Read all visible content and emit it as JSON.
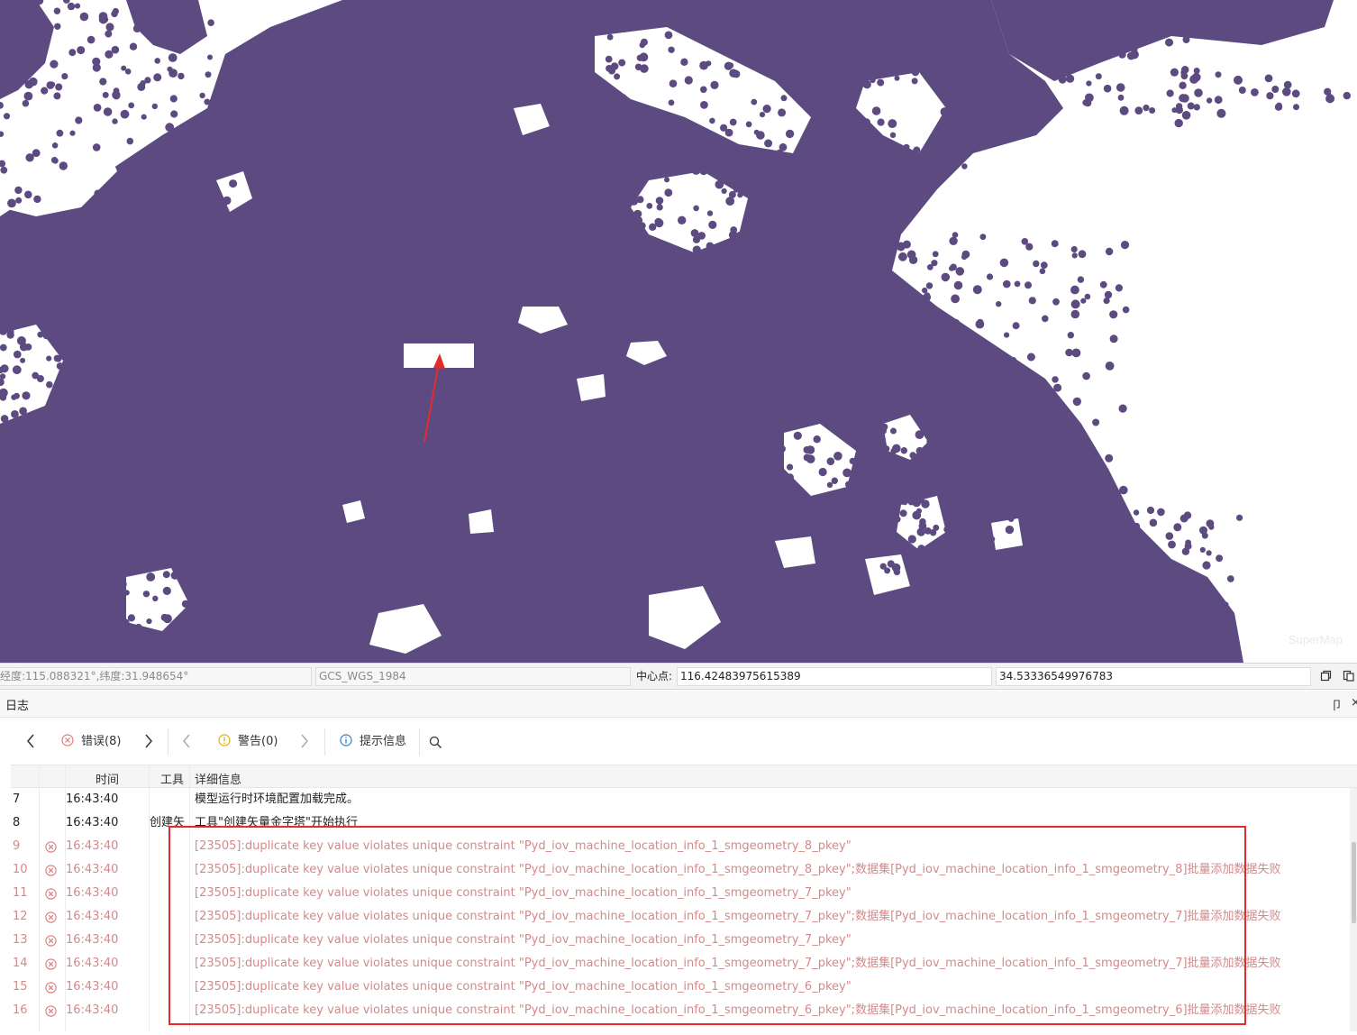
{
  "status_bar": {
    "coordinates": "经度:115.088321°,纬度:31.948654°",
    "crs": "GCS_WGS_1984",
    "center_label": "中心点:",
    "center_x": "116.42483975615389",
    "center_y": "34.53336549976783"
  },
  "map": {
    "point_color": "#5c4a80",
    "watermark": "SuperMap"
  },
  "log_panel": {
    "title": "日志",
    "toolbar": {
      "errors_label": "错误(8)",
      "warnings_label": "警告(0)",
      "info_label": "提示信息"
    },
    "columns": [
      "",
      "",
      "时间",
      "工具",
      "详细信息"
    ],
    "rows": [
      {
        "index": "7",
        "time": "16:43:40",
        "tool": "",
        "message": "模型运行时环境配置加载完成。",
        "level": "info"
      },
      {
        "index": "8",
        "time": "16:43:40",
        "tool": "创建矢",
        "message": "工具\"创建矢量金字塔\"开始执行",
        "level": "info"
      },
      {
        "index": "9",
        "time": "16:43:40",
        "tool": "",
        "message": "[23505]:duplicate key value violates unique constraint \"Pyd_iov_machine_location_info_1_smgeometry_8_pkey\"",
        "level": "error"
      },
      {
        "index": "10",
        "time": "16:43:40",
        "tool": "",
        "message": "[23505]:duplicate key value violates unique constraint \"Pyd_iov_machine_location_info_1_smgeometry_8_pkey\";数据集[Pyd_iov_machine_location_info_1_smgeometry_8]批量添加数据失败",
        "level": "error"
      },
      {
        "index": "11",
        "time": "16:43:40",
        "tool": "",
        "message": "[23505]:duplicate key value violates unique constraint \"Pyd_iov_machine_location_info_1_smgeometry_7_pkey\"",
        "level": "error"
      },
      {
        "index": "12",
        "time": "16:43:40",
        "tool": "",
        "message": "[23505]:duplicate key value violates unique constraint \"Pyd_iov_machine_location_info_1_smgeometry_7_pkey\";数据集[Pyd_iov_machine_location_info_1_smgeometry_7]批量添加数据失败",
        "level": "error"
      },
      {
        "index": "13",
        "time": "16:43:40",
        "tool": "",
        "message": "[23505]:duplicate key value violates unique constraint \"Pyd_iov_machine_location_info_1_smgeometry_7_pkey\"",
        "level": "error"
      },
      {
        "index": "14",
        "time": "16:43:40",
        "tool": "",
        "message": "[23505]:duplicate key value violates unique constraint \"Pyd_iov_machine_location_info_1_smgeometry_7_pkey\";数据集[Pyd_iov_machine_location_info_1_smgeometry_7]批量添加数据失败",
        "level": "error"
      },
      {
        "index": "15",
        "time": "16:43:40",
        "tool": "",
        "message": "[23505]:duplicate key value violates unique constraint \"Pyd_iov_machine_location_info_1_smgeometry_6_pkey\"",
        "level": "error"
      },
      {
        "index": "16",
        "time": "16:43:40",
        "tool": "",
        "message": "[23505]:duplicate key value violates unique constraint \"Pyd_iov_machine_location_info_1_smgeometry_6_pkey\";数据集[Pyd_iov_machine_location_info_1_smgeometry_6]批量添加数据失败",
        "level": "error"
      }
    ]
  },
  "colors": {
    "error_text": "#d38a8a",
    "highlight_box": "#e52b2b",
    "annotation_arrow": "#e52b2b"
  }
}
